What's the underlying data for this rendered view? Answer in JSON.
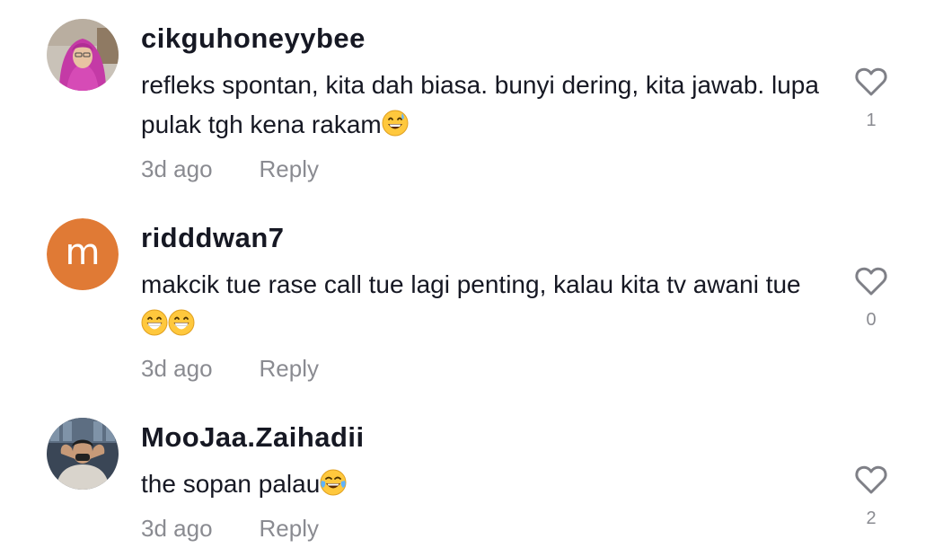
{
  "comments": [
    {
      "username": "cikguhoneyybee",
      "text": "refleks spontan, kita dah biasa. bunyi dering, kita jawab. lupa pulak tgh kena rakam",
      "emojis": [
        "grinning-sweat"
      ],
      "time": "3d ago",
      "reply_label": "Reply",
      "likes": "1",
      "avatar": {
        "kind": "photo",
        "description_icon": "woman-hijab-avatar"
      }
    },
    {
      "username": "ridddwan7",
      "text": "makcik tue rase call tue lagi penting, kalau kita tv awani tue",
      "emojis": [
        "beaming-grin",
        "beaming-grin"
      ],
      "time": "3d ago",
      "reply_label": "Reply",
      "likes": "0",
      "avatar": {
        "kind": "letter",
        "letter": "m",
        "color": "#e07a35"
      }
    },
    {
      "username": "MooJaa.Zaihadii",
      "text": "the sopan palau",
      "emojis": [
        "tears-of-joy"
      ],
      "time": "3d ago",
      "reply_label": "Reply",
      "likes": "2",
      "avatar": {
        "kind": "photo",
        "description_icon": "man-avatar"
      }
    }
  ],
  "colors": {
    "text": "#161823",
    "secondary": "#8a8b91",
    "heart_outline": "#7f8087",
    "emoji_yellow": "#ffc83d"
  }
}
